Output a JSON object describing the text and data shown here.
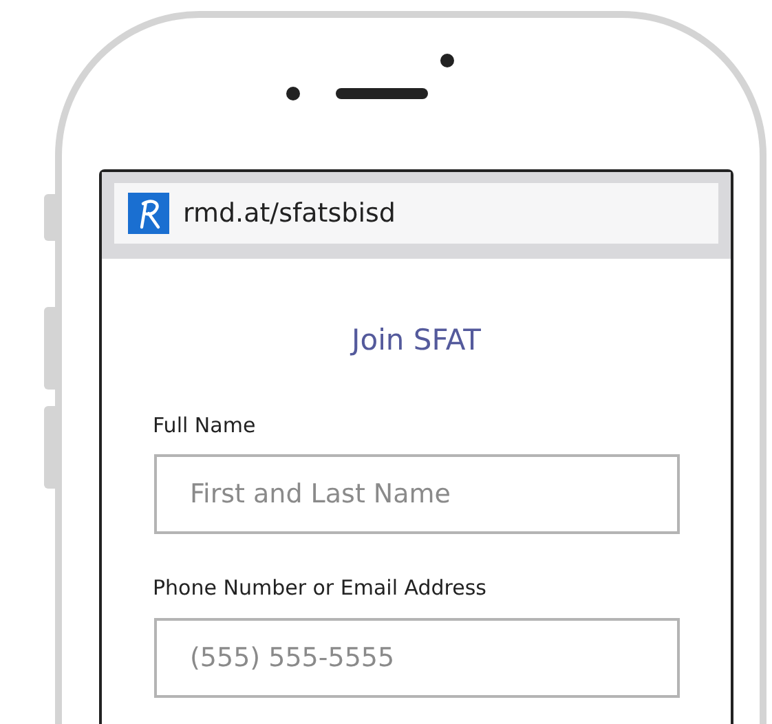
{
  "browser": {
    "url": "rmd.at/sfatsbisd"
  },
  "form": {
    "title": "Join SFAT",
    "fields": [
      {
        "label": "Full Name",
        "placeholder": "First and Last Name"
      },
      {
        "label": "Phone Number or Email Address",
        "placeholder": "(555) 555-5555"
      }
    ]
  }
}
